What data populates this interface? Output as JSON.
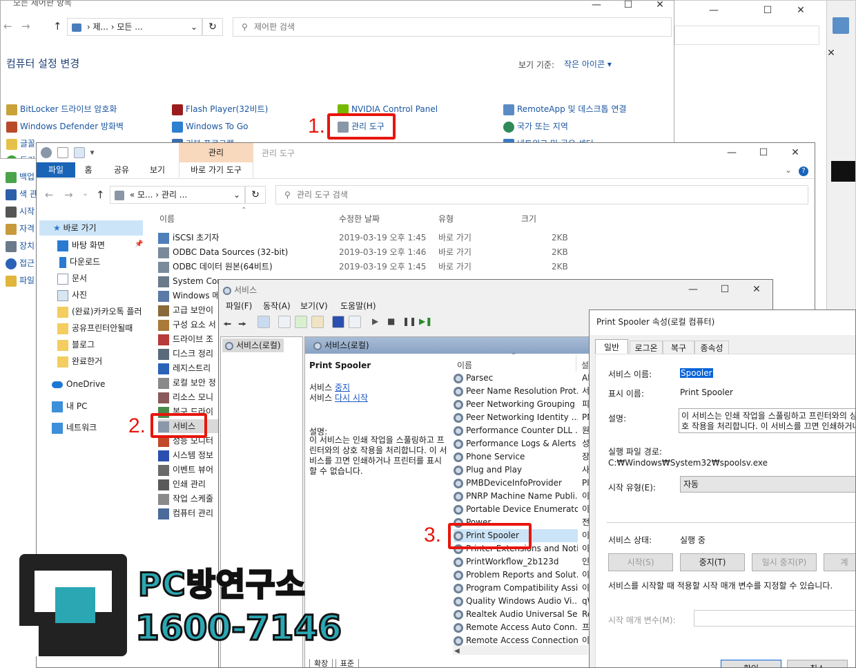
{
  "cp": {
    "title": "모든 제어판 항목",
    "addr": [
      "제...",
      "모든 ..."
    ],
    "search_placeholder": "제어판 검색",
    "heading": "컴퓨터 설정 변경",
    "view_label": "보기 기준:",
    "view_value": "작은 아이콘",
    "items": [
      {
        "label": "BitLocker 드라이브 암호화"
      },
      {
        "label": "Flash Player(32비트)"
      },
      {
        "label": "NVIDIA Control Panel"
      },
      {
        "label": "RemoteApp 및 데스크톱 연결"
      },
      {
        "label": "Windows Defender 방화벽"
      },
      {
        "label": "Windows To Go"
      },
      {
        "label": "관리 도구"
      },
      {
        "label": "국가 또는 지역"
      },
      {
        "label": "글꼴"
      },
      {
        "label": "기본 프로그램"
      },
      {
        "label": "네트워크 및 공유 센터"
      },
      {
        "label": "동기"
      },
      {
        "label": "백업"
      },
      {
        "label": "색 관"
      },
      {
        "label": "시작"
      },
      {
        "label": "자격"
      },
      {
        "label": "장치"
      },
      {
        "label": "접근"
      },
      {
        "label": "파일"
      }
    ]
  },
  "explorer": {
    "ribbon_context_group": "관리",
    "title": "관리 도구",
    "tabs": [
      "파일",
      "홈",
      "공유",
      "보기",
      "바로 가기 도구"
    ],
    "addr": [
      "모...",
      "관리 ..."
    ],
    "search_placeholder": "관리 도구 검색",
    "nav": [
      {
        "label": "바로 가기"
      },
      {
        "label": "바탕 화면"
      },
      {
        "label": "다운로드"
      },
      {
        "label": "문서"
      },
      {
        "label": "사진"
      },
      {
        "label": "(완료)카카오톡 플러"
      },
      {
        "label": "공유프린터안될때"
      },
      {
        "label": "블로그"
      },
      {
        "label": "완료한거"
      },
      {
        "label": "OneDrive"
      },
      {
        "label": "내 PC"
      },
      {
        "label": "네트워크"
      }
    ],
    "columns": [
      "이름",
      "수정한 날짜",
      "유형",
      "크기"
    ],
    "files": [
      {
        "name": "iSCSI 초기자",
        "date": "2019-03-19 오후 1:45",
        "type": "바로 가기",
        "size": "2KB"
      },
      {
        "name": "ODBC Data Sources (32-bit)",
        "date": "2019-03-19 오후 1:46",
        "type": "바로 가기",
        "size": "2KB"
      },
      {
        "name": "ODBC 데이터 원본(64비트)",
        "date": "2019-03-19 오후 1:45",
        "type": "바로 가기",
        "size": "2KB"
      },
      {
        "name": "System Con"
      },
      {
        "name": "Windows 메"
      },
      {
        "name": "고급 보안이"
      },
      {
        "name": "구성 요소 서"
      },
      {
        "name": "드라이브 조"
      },
      {
        "name": "디스크 정리"
      },
      {
        "name": "레지스트리"
      },
      {
        "name": "로컬 보안 정"
      },
      {
        "name": "리소스 모니"
      },
      {
        "name": "복구 드라이"
      },
      {
        "name": "서비스"
      },
      {
        "name": "성능 모니터"
      },
      {
        "name": "시스템 정보"
      },
      {
        "name": "이벤트 뷰어"
      },
      {
        "name": "인쇄 관리"
      },
      {
        "name": "작업 스케줄"
      },
      {
        "name": "컴퓨터 관리"
      }
    ]
  },
  "services": {
    "title": "서비스",
    "menus": [
      "파일(F)",
      "동작(A)",
      "보기(V)",
      "도움말(H)"
    ],
    "tree_item": "서비스(로컬)",
    "pane_header": "서비스(로컬)",
    "selected_name": "Print Spooler",
    "action_prefix": "서비스",
    "stop_link": "중지",
    "restart_link": "다시 시작",
    "desc_label": "설명:",
    "desc_text": "이 서비스는 인쇄 작업을 스풀링하고 프린터와의 상호 작용을 처리합니다. 이 서비스를 끄면 인쇄하거나 프린터를 표시할 수 없습니다.",
    "col_name": "이름",
    "col_desc": "설",
    "list": [
      {
        "name": "Parsec",
        "d": "All"
      },
      {
        "name": "Peer Name Resolution Prot...",
        "d": "서"
      },
      {
        "name": "Peer Networking Grouping",
        "d": "피"
      },
      {
        "name": "Peer Networking Identity ...",
        "d": "PN"
      },
      {
        "name": "Performance Counter DLL ...",
        "d": "원"
      },
      {
        "name": "Performance Logs & Alerts",
        "d": "성"
      },
      {
        "name": "Phone Service",
        "d": "장"
      },
      {
        "name": "Plug and Play",
        "d": "사"
      },
      {
        "name": "PMBDeviceInfoProvider",
        "d": "Pla"
      },
      {
        "name": "PNRP Machine Name Publi...",
        "d": "이"
      },
      {
        "name": "Portable Device Enumerato...",
        "d": "이"
      },
      {
        "name": "Power",
        "d": "전"
      },
      {
        "name": "Print Spooler",
        "d": "이"
      },
      {
        "name": "Printer Extensions and Noti...",
        "d": "이"
      },
      {
        "name": "PrintWorkflow_2b123d",
        "d": "인"
      },
      {
        "name": "Problem Reports and Solut...",
        "d": "이"
      },
      {
        "name": "Program Compatibility Assi...",
        "d": "이"
      },
      {
        "name": "Quality Windows Audio Vi...",
        "d": "qW"
      },
      {
        "name": "Realtek Audio Universal Ser...",
        "d": "Re"
      },
      {
        "name": "Remote Access Auto Conn...",
        "d": "프"
      },
      {
        "name": "Remote Access Connection...",
        "d": "이"
      }
    ],
    "bottom_tabs": [
      "확장",
      "표준"
    ]
  },
  "props": {
    "title": "Print Spooler 속성(로컬 컴퓨터)",
    "tabs": [
      "일반",
      "로그온",
      "복구",
      "종속성"
    ],
    "service_name_label": "서비스 이름:",
    "service_name": "Spooler",
    "display_name_label": "표시 이름:",
    "display_name": "Print Spooler",
    "desc_label": "설명:",
    "desc": "이 서비스는 인쇄 작업을 스풀링하고 프린터와의 상호 작용을 처리합니다. 이 서비스를 끄면 인쇄하거나 프린터를 표시할 수 없습니다.",
    "path_label": "실행 파일 경로:",
    "path": "C:₩Windows₩System32₩spoolsv.exe",
    "startup_label": "시작 유형(E):",
    "startup_value": "자동",
    "status_label": "서비스 상태:",
    "status_value": "실행 중",
    "buttons": [
      "시작(S)",
      "중지(T)",
      "일시 중지(P)",
      "계"
    ],
    "param_note": "서비스를 시작할 때 적용할 시작 매개 변수를 지정할 수 있습니다.",
    "param_label": "시작 매개 변수(M):",
    "ok": "확인",
    "cancel": "취소"
  },
  "annotations": {
    "step1": "1.",
    "step2": "2.",
    "step3": "3."
  },
  "watermark": {
    "name": "PC방연구소",
    "phone": "1600-7146"
  }
}
